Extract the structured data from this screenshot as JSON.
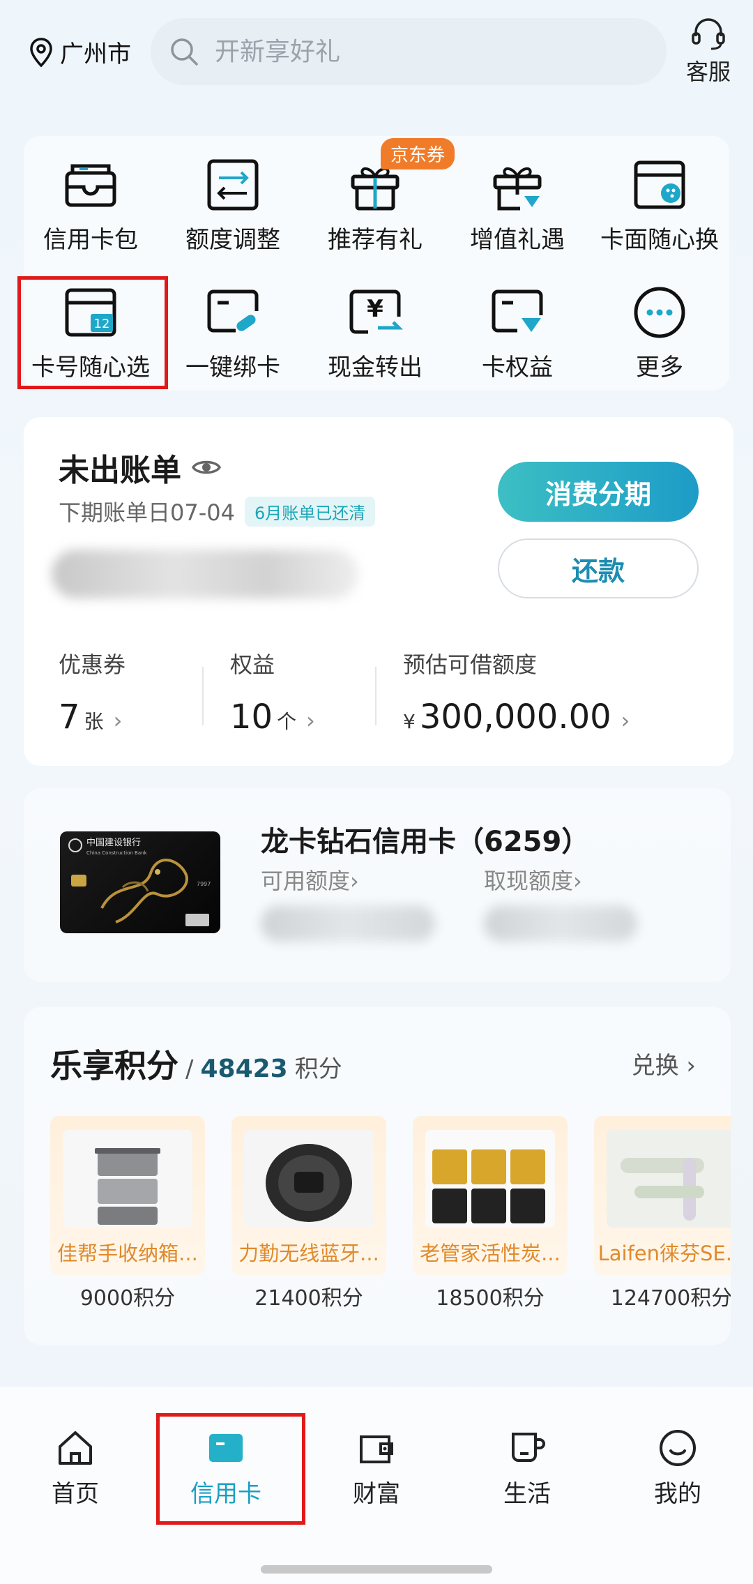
{
  "header": {
    "city": "广州市",
    "search_placeholder": "开新享好礼",
    "service_label": "客服"
  },
  "menu": {
    "badge": "京东券",
    "items": [
      {
        "label": "信用卡包",
        "icon": "card-wallet-icon"
      },
      {
        "label": "额度调整",
        "icon": "limit-adjust-icon"
      },
      {
        "label": "推荐有礼",
        "icon": "gift-box-icon"
      },
      {
        "label": "增值礼遇",
        "icon": "gift-diamond-icon"
      },
      {
        "label": "卡面随心换",
        "icon": "card-palette-icon"
      },
      {
        "label": "卡号随心选",
        "icon": "card-number-icon"
      },
      {
        "label": "一键绑卡",
        "icon": "bind-card-icon"
      },
      {
        "label": "现金转出",
        "icon": "cash-out-icon"
      },
      {
        "label": "卡权益",
        "icon": "card-benefit-icon"
      },
      {
        "label": "更多",
        "icon": "more-icon"
      }
    ]
  },
  "bill": {
    "title": "未出账单",
    "next_date": "下期账单日07-04",
    "paid_tag": "6月账单已还清",
    "installment_button": "消费分期",
    "repay_button": "还款",
    "stats": [
      {
        "label": "优惠券",
        "value": "7",
        "unit": "张"
      },
      {
        "label": "权益",
        "value": "10",
        "unit": "个"
      },
      {
        "label": "预估可借额度",
        "value": "300,000.00",
        "prefix": "¥"
      }
    ]
  },
  "card": {
    "name": "龙卡钻石信用卡（6259）",
    "available_label": "可用额度",
    "cash_label": "取现额度",
    "bank_name": "中国建设银行",
    "bank_name_en": "China Construction Bank",
    "card_tail": "7997"
  },
  "points": {
    "title": "乐享积分",
    "value": "48423",
    "unit": "积分",
    "exchange_label": "兑换",
    "products": [
      {
        "name": "佳帮手收纳箱...",
        "points": "9000积分"
      },
      {
        "name": "力勤无线蓝牙...",
        "points": "21400积分"
      },
      {
        "name": "老管家活性炭...",
        "points": "18500积分"
      },
      {
        "name": "Laifen徕芬SE...",
        "points": "124700积分"
      }
    ]
  },
  "nav": {
    "tabs": [
      {
        "label": "首页",
        "icon": "home-icon"
      },
      {
        "label": "信用卡",
        "icon": "credit-card-icon"
      },
      {
        "label": "财富",
        "icon": "wallet-icon"
      },
      {
        "label": "生活",
        "icon": "cup-icon"
      },
      {
        "label": "我的",
        "icon": "smile-icon"
      }
    ],
    "active": "信用卡"
  },
  "colors": {
    "accent": "#1a9fc4",
    "highlight_box": "#e01919",
    "badge": "#f07c2a"
  }
}
